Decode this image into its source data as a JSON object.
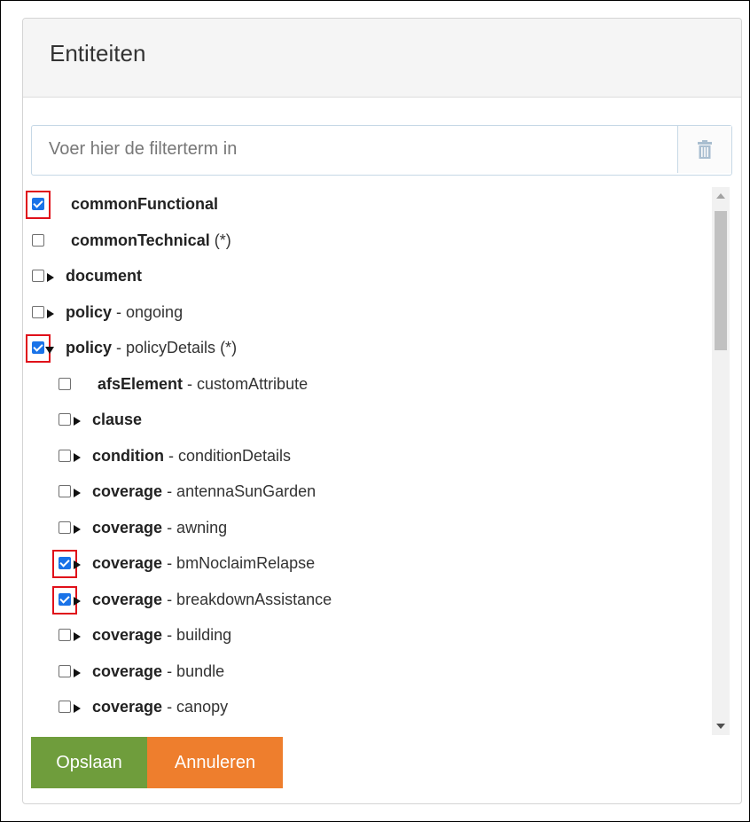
{
  "panel": {
    "title": "Entiteiten"
  },
  "filter": {
    "placeholder": "Voer hier de filterterm in",
    "value": "",
    "clear_icon": "trash-icon"
  },
  "tree": [
    {
      "name": "commonFunctional",
      "detail": "",
      "suffix": "",
      "checked": true,
      "level": 0,
      "expander": "none",
      "highlighted": true
    },
    {
      "name": "commonTechnical",
      "detail": "",
      "suffix": " (*)",
      "checked": false,
      "level": 0,
      "expander": "none",
      "highlighted": false
    },
    {
      "name": "document",
      "detail": "",
      "suffix": "",
      "checked": false,
      "level": 0,
      "expander": "collapsed",
      "highlighted": false
    },
    {
      "name": "policy",
      "detail": " - ongoing",
      "suffix": "",
      "checked": false,
      "level": 0,
      "expander": "collapsed",
      "highlighted": false
    },
    {
      "name": "policy",
      "detail": " - policyDetails",
      "suffix": " (*)",
      "checked": true,
      "level": 0,
      "expander": "expanded",
      "highlighted": true
    },
    {
      "name": "afsElement",
      "detail": " - customAttribute",
      "suffix": "",
      "checked": false,
      "level": 1,
      "expander": "none",
      "highlighted": false
    },
    {
      "name": "clause",
      "detail": "",
      "suffix": "",
      "checked": false,
      "level": 1,
      "expander": "collapsed",
      "highlighted": false
    },
    {
      "name": "condition",
      "detail": " - conditionDetails",
      "suffix": "",
      "checked": false,
      "level": 1,
      "expander": "collapsed",
      "highlighted": false
    },
    {
      "name": "coverage",
      "detail": " - antennaSunGarden",
      "suffix": "",
      "checked": false,
      "level": 1,
      "expander": "collapsed",
      "highlighted": false
    },
    {
      "name": "coverage",
      "detail": " - awning",
      "suffix": "",
      "checked": false,
      "level": 1,
      "expander": "collapsed",
      "highlighted": false
    },
    {
      "name": "coverage",
      "detail": " - bmNoclaimRelapse",
      "suffix": "",
      "checked": true,
      "level": 1,
      "expander": "collapsed",
      "highlighted": true
    },
    {
      "name": "coverage",
      "detail": " - breakdownAssistance",
      "suffix": "",
      "checked": true,
      "level": 1,
      "expander": "collapsed",
      "highlighted": true
    },
    {
      "name": "coverage",
      "detail": " - building",
      "suffix": "",
      "checked": false,
      "level": 1,
      "expander": "collapsed",
      "highlighted": false
    },
    {
      "name": "coverage",
      "detail": " - bundle",
      "suffix": "",
      "checked": false,
      "level": 1,
      "expander": "collapsed",
      "highlighted": false
    },
    {
      "name": "coverage",
      "detail": " - canopy",
      "suffix": "",
      "checked": false,
      "level": 1,
      "expander": "collapsed",
      "highlighted": false
    },
    {
      "name": "",
      "detail": "",
      "suffix": "",
      "checked": false,
      "level": 1,
      "expander": "none",
      "highlighted": false
    }
  ],
  "scroll": {
    "position_fraction": 0.0,
    "visible_fraction": 0.25
  },
  "actions": {
    "save_label": "Opslaan",
    "cancel_label": "Annuleren"
  },
  "colors": {
    "save": "#6f9d3c",
    "cancel": "#ee7e2d",
    "checkbox": "#1a73e8",
    "highlight": "#e0101a"
  }
}
